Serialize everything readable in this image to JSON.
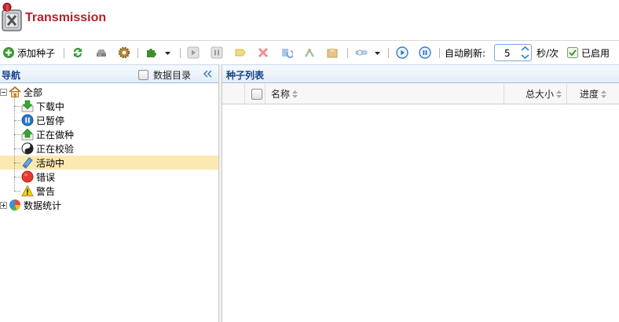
{
  "app": {
    "title": "Transmission"
  },
  "toolbar": {
    "add_torrent_label": "添加种子",
    "auto_refresh_label": "自动刷新:",
    "refresh_interval": "5",
    "interval_unit": "秒/次",
    "enabled_label": "已启用",
    "enabled_checked": true
  },
  "nav": {
    "title": "导航",
    "data_dir_label": "数据目录",
    "items": [
      {
        "label": "全部",
        "icon": "home-icon"
      },
      {
        "label": "下载中",
        "icon": "download-icon"
      },
      {
        "label": "已暂停",
        "icon": "pause-icon"
      },
      {
        "label": "正在做种",
        "icon": "upload-icon"
      },
      {
        "label": "正在校验",
        "icon": "yin-yang-icon"
      },
      {
        "label": "活动中",
        "icon": "activity-icon"
      },
      {
        "label": "错误",
        "icon": "error-icon"
      },
      {
        "label": "警告",
        "icon": "warning-icon"
      },
      {
        "label": "数据统计",
        "icon": "pie-chart-icon"
      }
    ],
    "selected": "活动中"
  },
  "torrent_list": {
    "title": "种子列表",
    "columns": [
      "名称",
      "总大小",
      "进度"
    ],
    "rows": []
  },
  "colors": {
    "brand": "#b8202a",
    "header_text": "#15428b",
    "selection": "#fce8b1"
  }
}
